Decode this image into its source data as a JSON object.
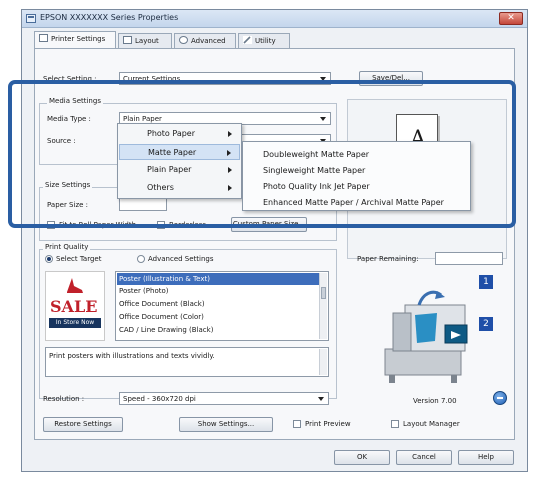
{
  "window": {
    "title": "EPSON XXXXXXX Series Properties",
    "close_label": "✕"
  },
  "tabs": [
    {
      "label": "Printer Settings",
      "icon": "printer-icon"
    },
    {
      "label": "Layout",
      "icon": "layout-icon"
    },
    {
      "label": "Advanced",
      "icon": "advanced-icon"
    },
    {
      "label": "Utility",
      "icon": "utility-icon"
    }
  ],
  "select_setting": {
    "label": "Select Setting :",
    "value": "Current Settings",
    "save_del_label": "Save/Del..."
  },
  "media_settings": {
    "group_label": "Media Settings",
    "media_type_label": "Media Type :",
    "media_type_value": "Plain Paper",
    "source_label": "Source :",
    "preview_glyph": "A"
  },
  "media_menu": {
    "items": [
      "Photo Paper",
      "Matte Paper",
      "Plain Paper",
      "Others"
    ],
    "highlighted_index": 1,
    "submenu": [
      "Doubleweight Matte Paper",
      "Singleweight Matte Paper",
      "Photo Quality Ink Jet Paper",
      "Enhanced Matte Paper / Archival Matte Paper"
    ]
  },
  "size_settings": {
    "group_label": "Size Settings",
    "paper_size_label": "Paper Size :",
    "fit_roll_label": "Fit to Roll Paper Width",
    "borderless_label": "Borderless",
    "custom_size_label": "Custom Paper Size..."
  },
  "print_quality": {
    "group_label": "Print Quality",
    "select_target_label": "Select Target",
    "advanced_label": "Advanced Settings",
    "targets": [
      "Poster (Illustration & Text)",
      "Poster (Photo)",
      "Office Document (Black)",
      "Office Document (Color)",
      "CAD / Line Drawing (Black)"
    ],
    "selected_index": 0,
    "description": "Print posters with illustrations and texts vividly.",
    "sale_text": "SALE",
    "in_store_text": "In Store Now"
  },
  "resolution": {
    "label": "Resolution :",
    "value": "Speed - 360x720 dpi"
  },
  "right_panel": {
    "paper_remaining_label": "Paper Remaining:",
    "badge1": "1",
    "badge2": "2",
    "version": "Version 7.00"
  },
  "bottom": {
    "restore_label": "Restore Settings",
    "show_settings_label": "Show Settings...",
    "print_preview_label": "Print Preview",
    "layout_manager_label": "Layout Manager"
  },
  "footer": {
    "ok_label": "OK",
    "cancel_label": "Cancel",
    "help_label": "Help"
  }
}
